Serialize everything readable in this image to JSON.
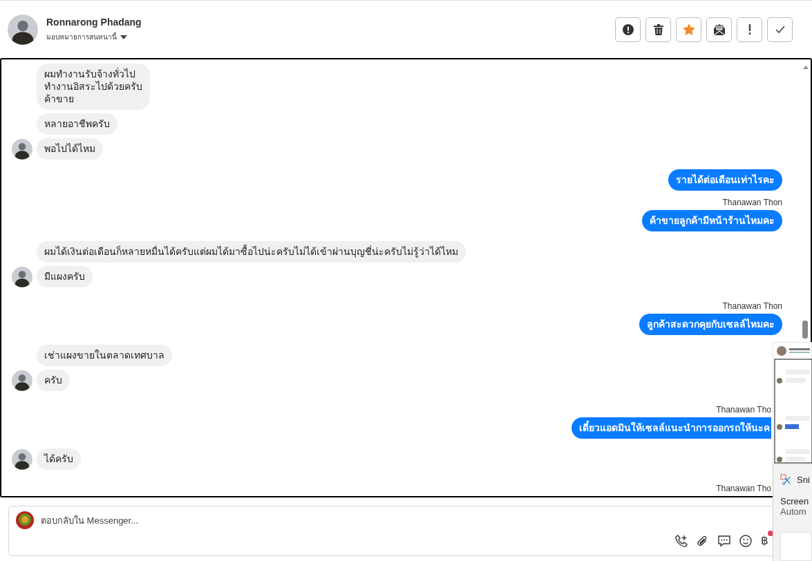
{
  "header": {
    "contact_name": "Ronnarong Phadang",
    "assign_label": "มอบหมายการสนทนานี้"
  },
  "actions": [
    {
      "kind": "alert",
      "on": false
    },
    {
      "kind": "trash",
      "on": false
    },
    {
      "kind": "star",
      "on": true
    },
    {
      "kind": "mail",
      "on": false
    },
    {
      "kind": "important",
      "on": false
    },
    {
      "kind": "done",
      "on": false
    }
  ],
  "messages": [
    {
      "kind": "incoming",
      "text": "ผมทำงานรับจ้างทั่วไป\nทำงานอิสระไปด้วยครับ\nค้าขาย",
      "avatar": false
    },
    {
      "kind": "incoming",
      "text": "หลายอาชีพครับ",
      "avatar": false
    },
    {
      "kind": "incoming",
      "text": "พอไปได้ไหม",
      "avatar": true
    },
    {
      "kind": "outgoing",
      "text": "รายได้ต่อเดือนเท่าไรคะ",
      "clipped": false
    },
    {
      "kind": "sender",
      "text": "Thanawan Thon"
    },
    {
      "kind": "outgoing",
      "text": "ค้าขายลูกค้ามีหน้าร้านไหมคะ",
      "clipped": false
    },
    {
      "kind": "incoming",
      "text": "ผมได้เงินต่อเดือนก็หลายหมื่นได้ครับแต่ผมได้มาซื้อไปน่ะครับไม่ได้เข้าผ่านบุญชี่น่ะครับไม่รู้ว่าได้ไหม",
      "avatar": false
    },
    {
      "kind": "incoming",
      "text": "มีแผงครับ",
      "avatar": true
    },
    {
      "kind": "sender",
      "text": "Thanawan Thon"
    },
    {
      "kind": "outgoing",
      "text": "ลูกค้าสะดวกคุยกับเซลล์ไหมคะ",
      "clipped": false
    },
    {
      "kind": "incoming",
      "text": "เช่าแผงขายในตลาดเทศบาล",
      "avatar": false
    },
    {
      "kind": "incoming",
      "text": "ครับ",
      "avatar": true
    },
    {
      "kind": "sender",
      "text": "Thanawan Tho"
    },
    {
      "kind": "outgoing",
      "text": "เดี๋ยวแอดมินให้เซลล์แนะนำการออกรถให้นะค",
      "clipped": true
    },
    {
      "kind": "incoming",
      "text": "ได้ครับ",
      "avatar": true
    },
    {
      "kind": "sender",
      "text": "Thanawan Tho"
    }
  ],
  "composer": {
    "placeholder": "ตอบกลับใน Messenger...",
    "currency_symbol": "฿"
  },
  "snip_toast": {
    "title": "Sni",
    "line_1": "Screen",
    "line_2": "Autom"
  }
}
